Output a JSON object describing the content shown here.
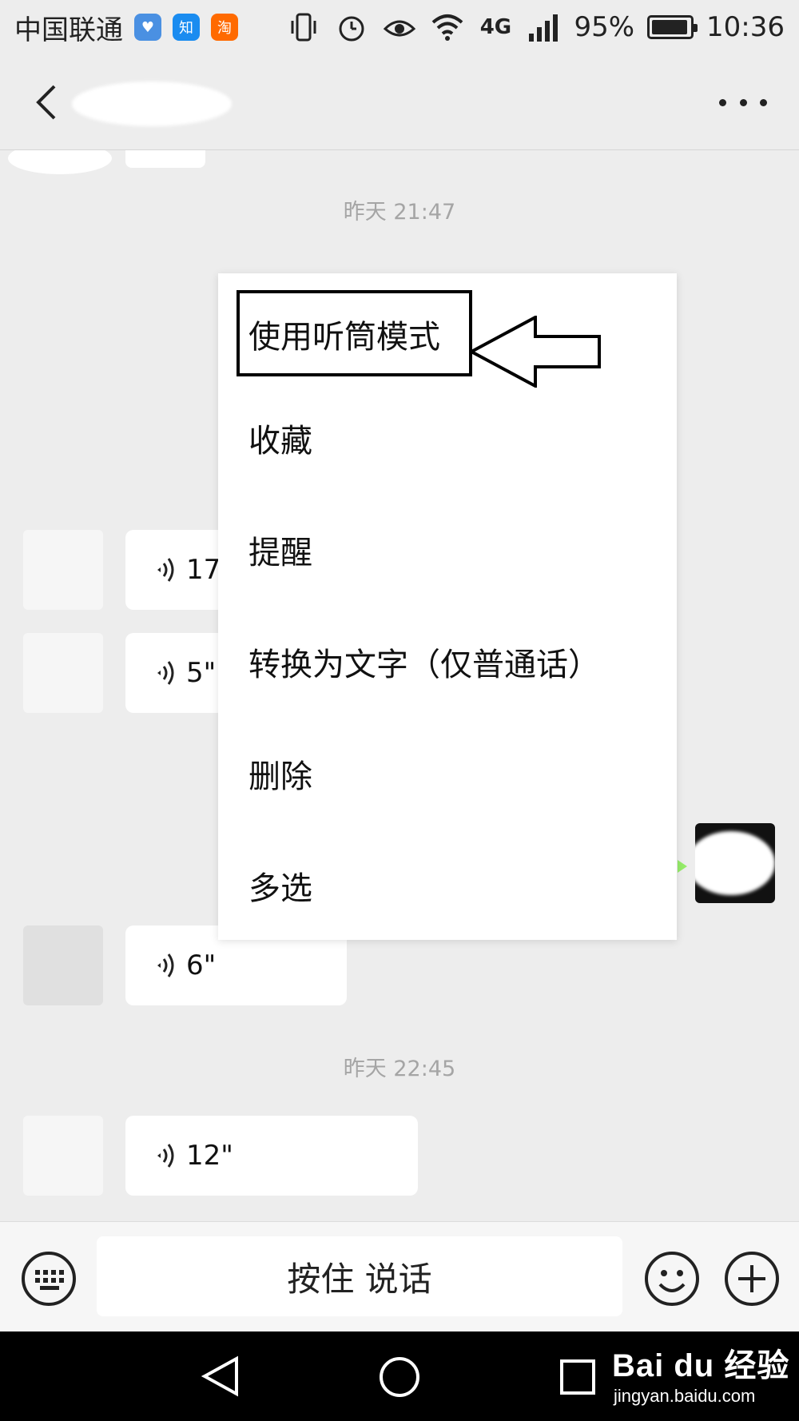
{
  "status_bar": {
    "carrier": "中国联通",
    "apps": [
      {
        "icon": "health-icon",
        "color": "#3b8fe8",
        "glyph": "♥"
      },
      {
        "icon": "zhihu-icon",
        "color": "#2e8ee8",
        "glyph": "知"
      },
      {
        "icon": "taobao-icon",
        "color": "#ff6a00",
        "glyph": "淘"
      }
    ],
    "network_4g": "4G",
    "battery": "95%",
    "battery_level": 0.95,
    "time": "10:36"
  },
  "nav": {
    "title_redacted": true
  },
  "chat": {
    "timestamp_1": "昨天 21:47",
    "timestamp_2": "昨天 22:45",
    "voice_messages": [
      "17",
      "5\"",
      "6\"",
      "12\""
    ]
  },
  "context_menu": {
    "items": [
      "使用听筒模式",
      "收藏",
      "提醒",
      "转换为文字（仅普通话）",
      "删除",
      "多选"
    ]
  },
  "input_bar": {
    "talk_label": "按住 说话"
  },
  "watermark": {
    "main": "Bai du 经验",
    "sub": "jingyan.baidu.com"
  },
  "colors": {
    "background": "#ededed",
    "bubble": "#ffffff",
    "timestamp": "#a5a5a5"
  }
}
